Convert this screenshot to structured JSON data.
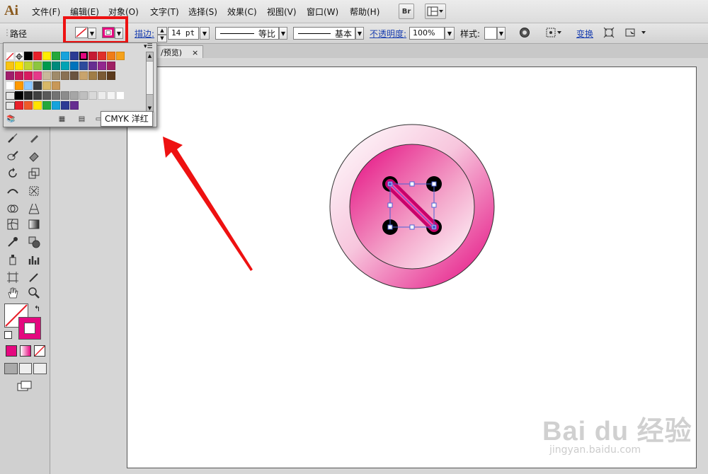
{
  "app": {
    "logo": "Ai"
  },
  "menubar": {
    "items": [
      {
        "label": "文件(F)"
      },
      {
        "label": "编辑(E)"
      },
      {
        "label": "对象(O)"
      },
      {
        "label": "文字(T)"
      },
      {
        "label": "选择(S)"
      },
      {
        "label": "效果(C)"
      },
      {
        "label": "视图(V)"
      },
      {
        "label": "窗口(W)"
      },
      {
        "label": "帮助(H)"
      }
    ],
    "bridge_label": "Br"
  },
  "controlbar": {
    "selection_label": "路径",
    "stroke_link": "描边:",
    "stroke_weight": "14 pt",
    "profile_label": "等比",
    "brush_label": "基本",
    "opacity_link": "不透明度:",
    "opacity_value": "100%",
    "style_label": "样式:",
    "transform_link": "变换"
  },
  "document": {
    "tab_title": "/预览)",
    "tab_close": "×"
  },
  "swatch_popup": {
    "tooltip": "CMYK 洋红",
    "rows": [
      [
        "#ffffff",
        "#000000",
        "#e8202a",
        "#ffee00",
        "#25a83b",
        "#16a3dc",
        "#2b3a94",
        "#e4087f",
        "#c51a32",
        "#e0302a",
        "#f07c18",
        "#f5a21b"
      ],
      [
        "#f9c411",
        "#ffe400",
        "#c2d730",
        "#8cc63f",
        "#009a4e",
        "#008a7c",
        "#00a3b4",
        "#0073bc",
        "#2d4a9c",
        "#662d91",
        "#92278f",
        "#9e1f63"
      ],
      [
        "#a01e6c",
        "#c2185b",
        "#d81b60",
        "#e6398a",
        "#c8b89a",
        "#a08b6a",
        "#8a7154",
        "#6b5440",
        "#c9a46d",
        "#a07d46",
        "#7b5a34",
        "#5b3a1c"
      ],
      [
        "#ffffff",
        "#ff9a00",
        "#8cc8ff",
        "#3c3c3c",
        "#d8b868",
        "#c89858"
      ],
      [
        "#000000",
        "#262626",
        "#404040",
        "#595959",
        "#737373",
        "#8c8c8c",
        "#a6a6a6",
        "#bfbfbf",
        "#d9d9d9",
        "#ececec",
        "#f4f4f4",
        "#ffffff"
      ],
      [
        "#e8202a",
        "#f05a28",
        "#ffe400",
        "#25a83b",
        "#16a3dc",
        "#2b3a94",
        "#662d91"
      ]
    ]
  },
  "colors": {
    "magenta": "#e4087f",
    "annotation_red": "#ee1111"
  },
  "watermark": {
    "text": "Bai du 经验",
    "url": "jingyan.baidu.com"
  }
}
